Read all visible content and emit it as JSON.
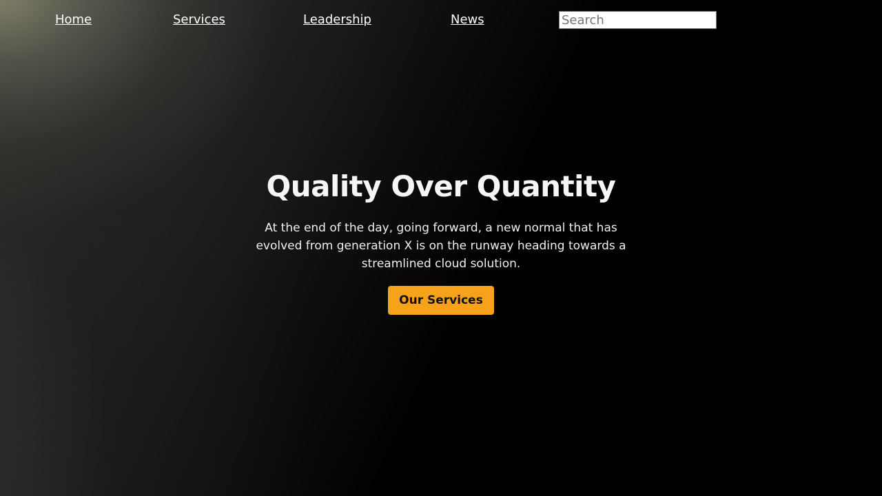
{
  "nav": {
    "items": [
      {
        "label": "Home"
      },
      {
        "label": "Services"
      },
      {
        "label": "Leadership"
      },
      {
        "label": "News"
      }
    ],
    "search": {
      "placeholder": "Search",
      "value": ""
    }
  },
  "hero": {
    "title": "Quality Over Quantity",
    "text": "At the end of the day, going forward, a new normal that has evolved from generation X is on the runway heading towards a streamlined cloud solution.",
    "button_label": "Our Services"
  },
  "colors": {
    "accent": "#f7a21b",
    "background": "#000000",
    "text": "#ffffff"
  }
}
